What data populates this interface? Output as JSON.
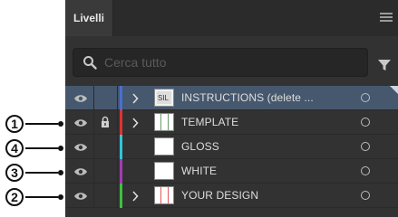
{
  "panel": {
    "tab_label": "Livelli",
    "search_placeholder": "Cerca tutto"
  },
  "layers": [
    {
      "label": "INSTRUCTIONS (delete ...",
      "color": "#4a6fd1",
      "locked": false,
      "expandable": true,
      "selected": true
    },
    {
      "label": "TEMPLATE",
      "color": "#e03131",
      "locked": true,
      "expandable": true,
      "selected": false
    },
    {
      "label": "GLOSS",
      "color": "#35c3d6",
      "locked": false,
      "expandable": false,
      "selected": false
    },
    {
      "label": "WHITE",
      "color": "#a23bb5",
      "locked": false,
      "expandable": false,
      "selected": false
    },
    {
      "label": "YOUR DESIGN",
      "color": "#3ec13e",
      "locked": false,
      "expandable": true,
      "selected": false
    }
  ],
  "callouts": [
    {
      "number": "1",
      "layer": "TEMPLATE"
    },
    {
      "number": "4",
      "layer": "GLOSS"
    },
    {
      "number": "3",
      "layer": "WHITE"
    },
    {
      "number": "2",
      "layer": "YOUR DESIGN"
    }
  ],
  "colors": {
    "panel_bg": "#323232",
    "selected_row": "#46586e",
    "text": "#dedede"
  }
}
